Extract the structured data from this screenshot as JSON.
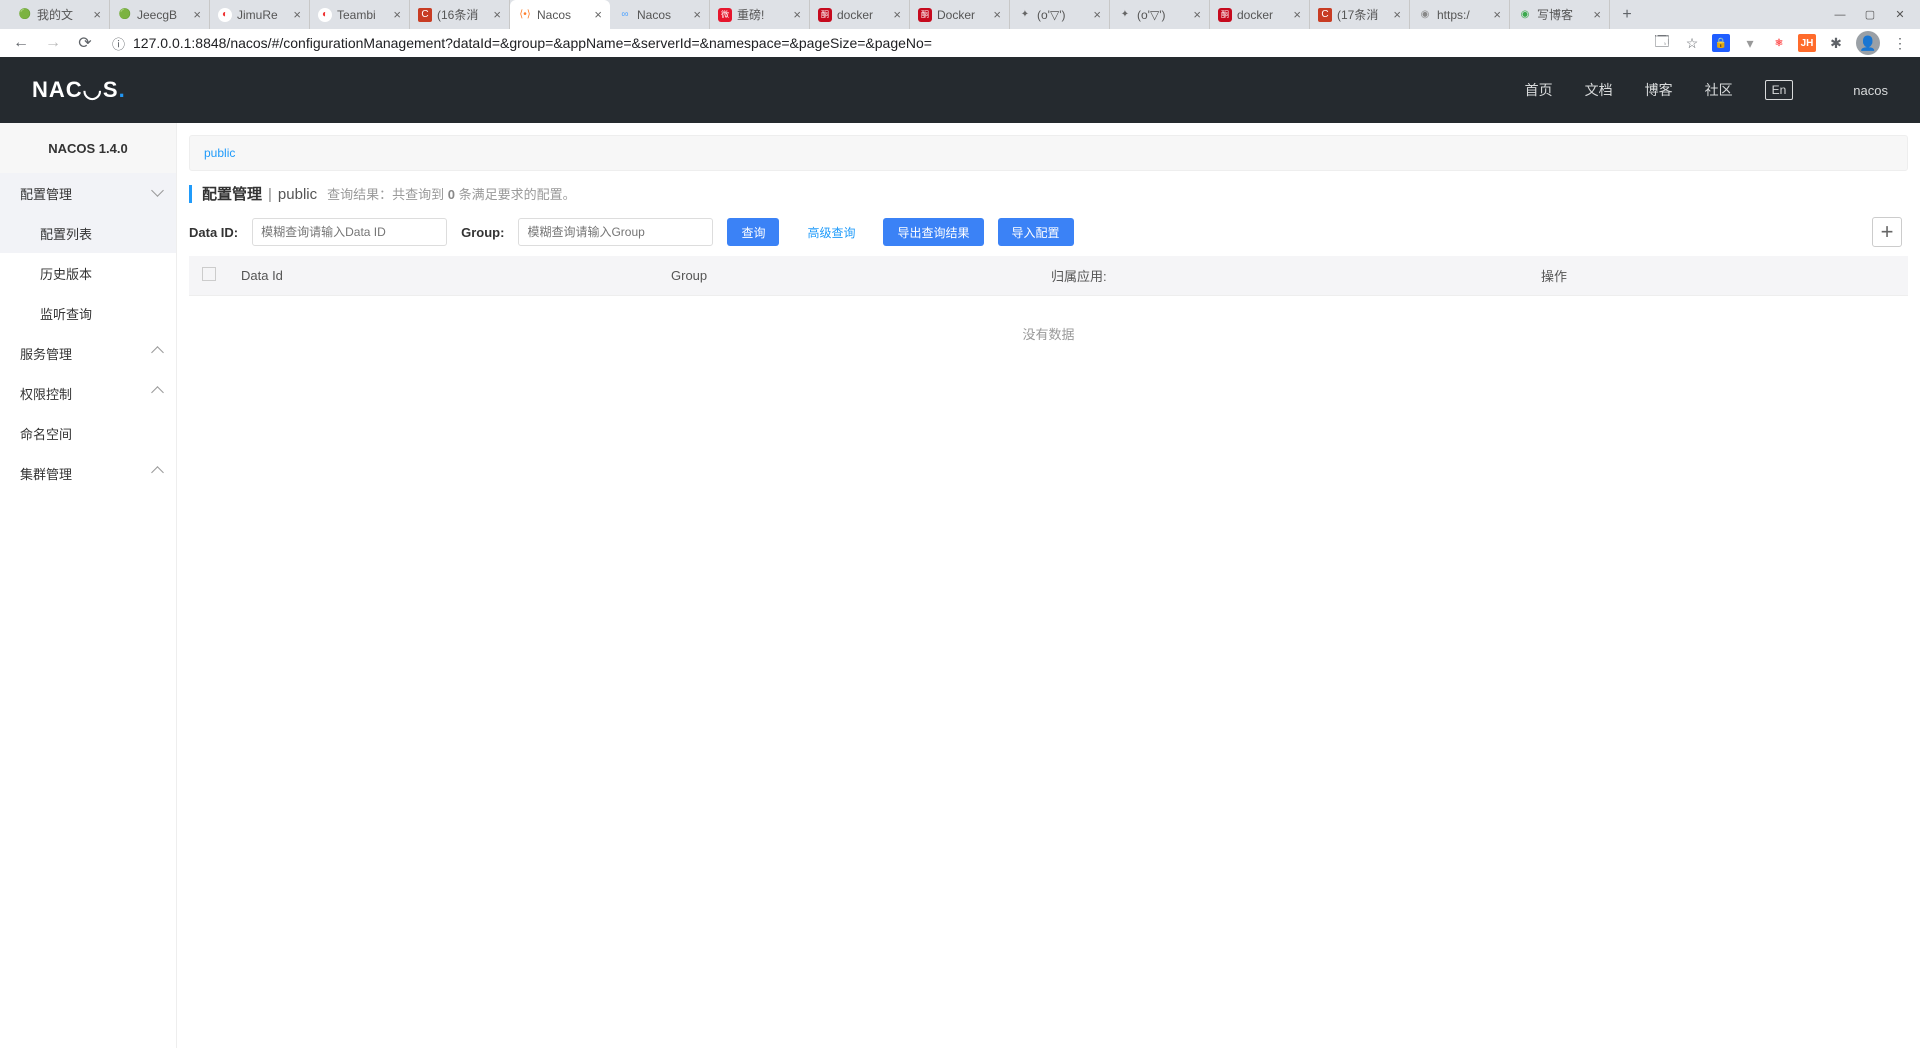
{
  "browser": {
    "tabs": [
      {
        "title": "我的文",
        "favicon": "🟢"
      },
      {
        "title": "JeecgB",
        "favicon": "🟢"
      },
      {
        "title": "JimuRe",
        "favicon": "🔵"
      },
      {
        "title": "Teambi",
        "favicon": "🔵"
      },
      {
        "title": "(16条消",
        "favicon": "C"
      },
      {
        "title": "Nacos",
        "favicon": "⟨⟩",
        "active": true
      },
      {
        "title": "Nacos",
        "favicon": "∞"
      },
      {
        "title": "重磅!",
        "favicon": "🔴"
      },
      {
        "title": "docker",
        "favicon": "酮"
      },
      {
        "title": "Docker",
        "favicon": "酮"
      },
      {
        "title": "(o'▽')",
        "favicon": "✦"
      },
      {
        "title": "(o'▽')",
        "favicon": "✦"
      },
      {
        "title": "docker",
        "favicon": "酮"
      },
      {
        "title": "(17条消",
        "favicon": "C"
      },
      {
        "title": "https:/",
        "favicon": "⬤"
      },
      {
        "title": "写博客",
        "favicon": "🟢"
      }
    ],
    "url": "127.0.0.1:8848/nacos/#/configurationManagement?dataId=&group=&appName=&serverId=&namespace=&pageSize=&pageNo="
  },
  "header": {
    "logo": "NACOS",
    "nav": {
      "home": "首页",
      "docs": "文档",
      "blog": "博客",
      "community": "社区"
    },
    "lang": "En",
    "user": "nacos"
  },
  "sidebar": {
    "version": "NACOS 1.4.0",
    "items": {
      "config_mgmt": "配置管理",
      "config_list": "配置列表",
      "history": "历史版本",
      "listen": "监听查询",
      "service_mgmt": "服务管理",
      "permission": "权限控制",
      "namespace": "命名空间",
      "cluster": "集群管理"
    }
  },
  "content": {
    "namespace_tab": "public",
    "page_title": "配置管理",
    "ns_name": "public",
    "result_prefix": "查询结果：共查询到 ",
    "result_count": "0",
    "result_suffix": " 条满足要求的配置。",
    "labels": {
      "dataId": "Data ID:",
      "group": "Group:"
    },
    "placeholders": {
      "dataId": "模糊查询请输入Data ID",
      "group": "模糊查询请输入Group"
    },
    "buttons": {
      "search": "查询",
      "adv": "高级查询",
      "export": "导出查询结果",
      "import": "导入配置"
    },
    "table": {
      "cols": {
        "dataId": "Data Id",
        "group": "Group",
        "app": "归属应用:",
        "ops": "操作"
      },
      "no_data": "没有数据"
    }
  }
}
